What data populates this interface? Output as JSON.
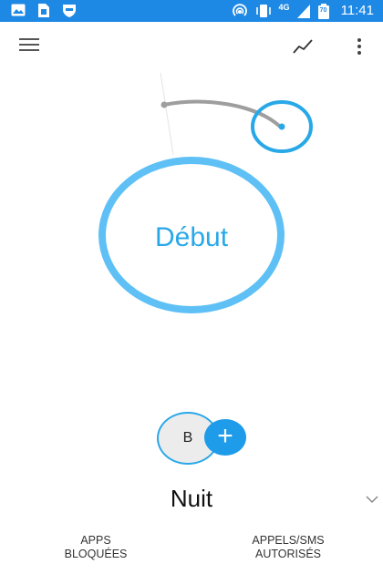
{
  "status_bar": {
    "time": "11:41",
    "network": "4G",
    "battery_level": "70",
    "icons": [
      "image-icon",
      "sim-card-icon",
      "shield-icon",
      "hotspot-icon",
      "vibrate-icon",
      "signal-icon",
      "battery-icon"
    ]
  },
  "app_bar": {
    "icons": [
      "menu-icon",
      "stats-icon",
      "more-vert-icon"
    ]
  },
  "dial": {
    "center_label": "Début",
    "accent_color": "#29a8e8",
    "arc_color": "#9e9e9e"
  },
  "profile": {
    "avatar_letter": "B",
    "add_label": "+"
  },
  "mode": {
    "title": "Nuit"
  },
  "bottom_tabs": {
    "apps_line1": "APPS",
    "apps_line2": "BLOQUÉES",
    "calls_line1": "APPELS/SMS",
    "calls_line2": "AUTORISÉS"
  },
  "colors": {
    "status_bar": "#1e88e5",
    "accent": "#29a8e8",
    "fab": "#1e9be9"
  }
}
